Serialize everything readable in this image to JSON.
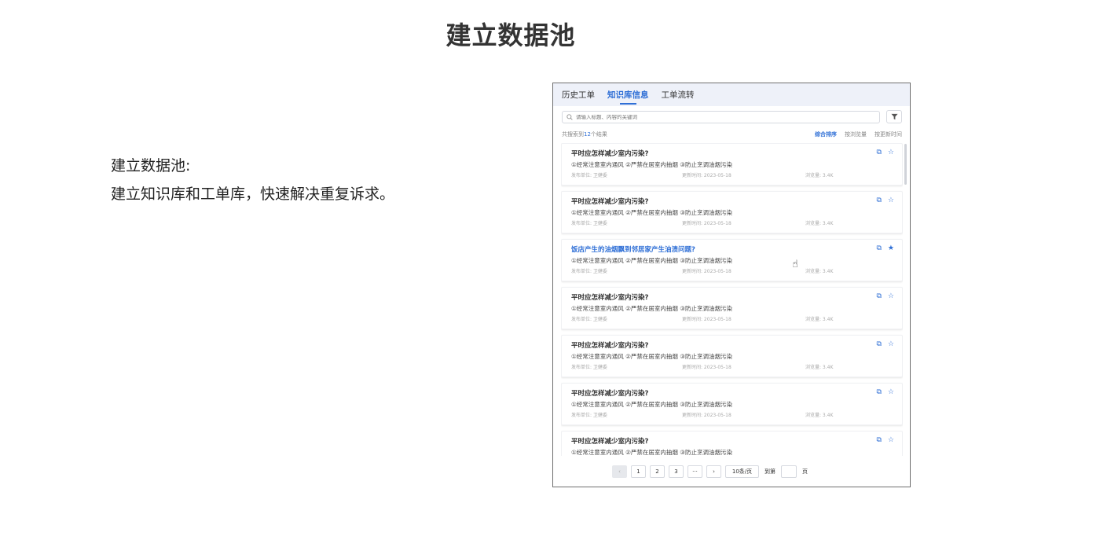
{
  "page": {
    "title": "建立数据池"
  },
  "description": {
    "line1": "建立数据池:",
    "line2": "建立知识库和工单库，快速解决重复诉求。"
  },
  "app": {
    "tabs": [
      {
        "label": "历史工单",
        "active": false
      },
      {
        "label": "知识库信息",
        "active": true
      },
      {
        "label": "工单流转",
        "active": false
      }
    ],
    "search": {
      "placeholder": "请输入标题、内容的关键词",
      "value": ""
    },
    "results": {
      "prefix": "共搜索到",
      "count": "12",
      "suffix": "个结果"
    },
    "sort_options": [
      {
        "label": "综合排序",
        "active": true
      },
      {
        "label": "按浏览量",
        "active": false
      },
      {
        "label": "按更新时间",
        "active": false
      }
    ],
    "items": [
      {
        "title": "平时应怎样减少室内污染?",
        "content": "①经常注意室内通风 ②严禁在居室内抽烟 ③防止烹调油烟污染",
        "publisher": "发布单位: 卫健委",
        "updated": "更新时间: 2023-05-18",
        "views": "浏览量: 3.4K",
        "starred": false,
        "highlighted": false
      },
      {
        "title": "平时应怎样减少室内污染?",
        "content": "①经常注意室内通风 ②严禁在居室内抽烟 ③防止烹调油烟污染",
        "publisher": "发布单位: 卫健委",
        "updated": "更新时间: 2023-05-18",
        "views": "浏览量: 3.4K",
        "starred": false,
        "highlighted": false
      },
      {
        "title": "饭店产生的油烟飘到邻居家产生油渍问题?",
        "content": "①经常注意室内通风 ②严禁在居室内抽烟 ③防止烹调油烟污染",
        "publisher": "发布单位: 卫健委",
        "updated": "更新时间: 2023-05-18",
        "views": "浏览量: 3.4K",
        "starred": true,
        "highlighted": true
      },
      {
        "title": "平时应怎样减少室内污染?",
        "content": "①经常注意室内通风 ②严禁在居室内抽烟 ③防止烹调油烟污染",
        "publisher": "发布单位: 卫健委",
        "updated": "更新时间: 2023-05-18",
        "views": "浏览量: 3.4K",
        "starred": false,
        "highlighted": false
      },
      {
        "title": "平时应怎样减少室内污染?",
        "content": "①经常注意室内通风 ②严禁在居室内抽烟 ③防止烹调油烟污染",
        "publisher": "发布单位: 卫健委",
        "updated": "更新时间: 2023-05-18",
        "views": "浏览量: 3.4K",
        "starred": false,
        "highlighted": false
      },
      {
        "title": "平时应怎样减少室内污染?",
        "content": "①经常注意室内通风 ②严禁在居室内抽烟 ③防止烹调油烟污染",
        "publisher": "发布单位: 卫健委",
        "updated": "更新时间: 2023-05-18",
        "views": "浏览量: 3.4K",
        "starred": false,
        "highlighted": false
      },
      {
        "title": "平时应怎样减少室内污染?",
        "content": "①经常注意室内通风 ②严禁在居室内抽烟 ③防止烹调油烟污染",
        "publisher": "",
        "updated": "",
        "views": "",
        "starred": false,
        "highlighted": false
      }
    ],
    "pagination": {
      "prev": "‹",
      "pages": [
        "1",
        "2",
        "3"
      ],
      "ellipsis": "···",
      "next": "›",
      "page_size": "10条/页",
      "goto_prefix": "到第",
      "goto_suffix": "页"
    },
    "accent_color": "#2f6fd6"
  }
}
